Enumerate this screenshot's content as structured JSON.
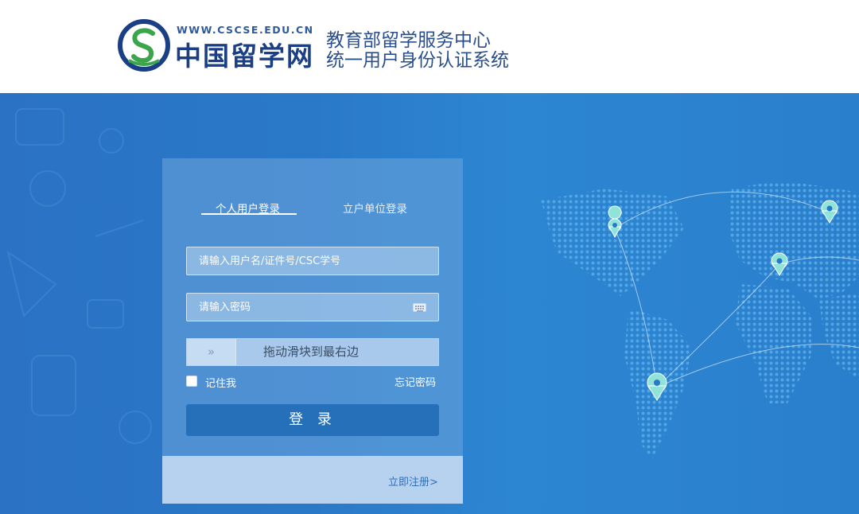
{
  "header": {
    "logo_url_text": "WWW.CSCSE.EDU.CN",
    "logo_name": "中国留学网",
    "system_line1": "教育部留学服务中心",
    "system_line2": "统一用户身份认证系统"
  },
  "login": {
    "tabs": [
      {
        "label": "个人用户登录",
        "active": true
      },
      {
        "label": "立户单位登录",
        "active": false
      }
    ],
    "username_placeholder": "请输入用户名/证件号/CSC学号",
    "password_placeholder": "请输入密码",
    "slider_handle": "»",
    "slider_text": "拖动滑块到最右边",
    "remember_label": "记住我",
    "forgot_label": "忘记密码",
    "login_button": "登 录",
    "register_link": "立即注册>"
  },
  "colors": {
    "brand_blue": "#1b3f86",
    "banner_blue": "#2a78c8",
    "button_blue": "#2570b8",
    "logo_green": "#3aa54a"
  }
}
